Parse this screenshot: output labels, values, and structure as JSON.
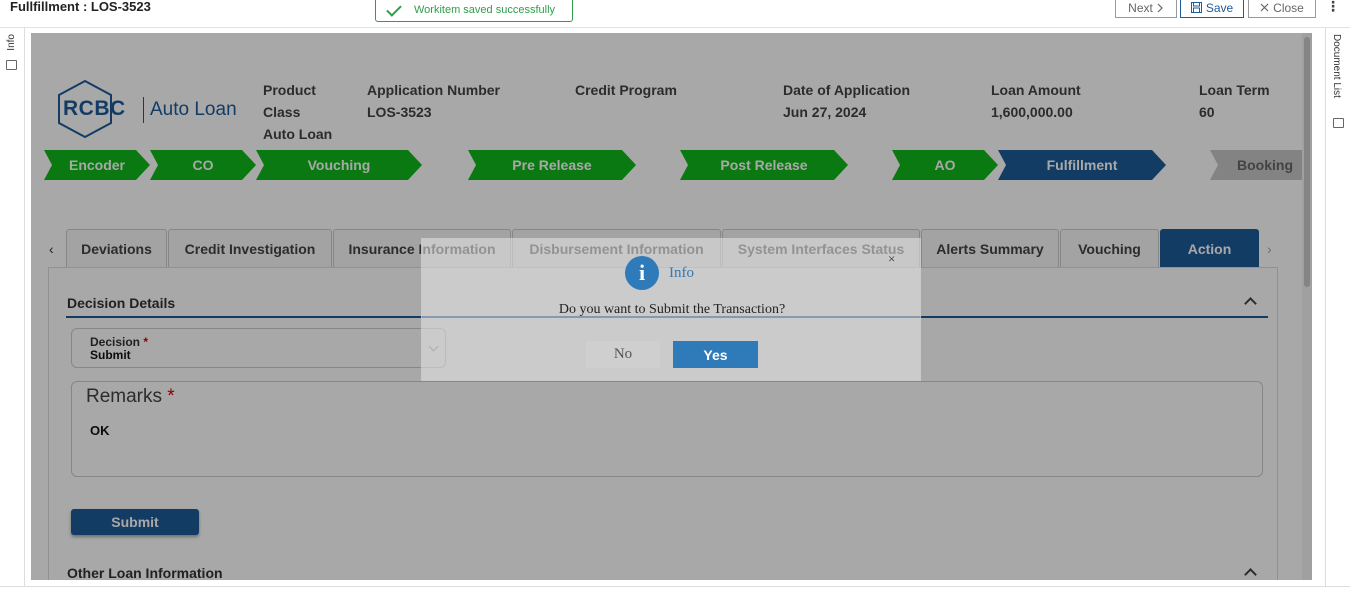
{
  "window": {
    "title": "Fullfillment : LOS-3523"
  },
  "toast": {
    "message": "Workitem saved successfully"
  },
  "toolbar": {
    "next_label": "Next",
    "save_label": "Save",
    "close_label": "Close"
  },
  "left_panel": {
    "label": "Info"
  },
  "right_panel": {
    "label": "Document List"
  },
  "brand": {
    "mark": "RCBC",
    "product": "Auto Loan"
  },
  "application": {
    "product_class_label_1": "Product",
    "product_class_label_2": "Class",
    "product_class_value": "Auto Loan",
    "app_number_label": "Application Number",
    "app_number_value": "LOS-3523",
    "credit_program_label": "Credit Program",
    "credit_program_value": "",
    "date_label": "Date of Application",
    "date_value": "Jun 27, 2024",
    "amount_label": "Loan Amount",
    "amount_value": "1,600,000.00",
    "term_label": "Loan Term",
    "term_value": "60"
  },
  "stages": [
    {
      "label": "Encoder",
      "status": "complete"
    },
    {
      "label": "CO",
      "status": "complete"
    },
    {
      "label": "Vouching",
      "status": "complete"
    },
    {
      "label": "Pre Release",
      "status": "complete"
    },
    {
      "label": "Post Release",
      "status": "complete"
    },
    {
      "label": "AO",
      "status": "complete"
    },
    {
      "label": "Fulfillment",
      "status": "current"
    },
    {
      "label": "Booking",
      "status": "pending"
    }
  ],
  "tabs": [
    {
      "label": "Deviations"
    },
    {
      "label": "Credit Investigation"
    },
    {
      "label": "Insurance Information"
    },
    {
      "label": "Disbursement Information"
    },
    {
      "label": "System Interfaces Status"
    },
    {
      "label": "Alerts Summary"
    },
    {
      "label": "Vouching"
    },
    {
      "label": "Action",
      "active": true
    }
  ],
  "decision_section": {
    "title": "Decision Details",
    "decision_label": "Decision",
    "required_mark": "*",
    "decision_value": "Submit",
    "remarks_label": "Remarks",
    "remarks_value": "OK",
    "submit_label": "Submit"
  },
  "other_section": {
    "title": "Other Loan Information"
  },
  "dialog": {
    "title": "Info",
    "icon_glyph": "i",
    "close_glyph": "×",
    "question": "Do you want to Submit the Transaction?",
    "no_label": "No",
    "yes_label": "Yes"
  },
  "colors": {
    "brand_blue": "#1e5b9a",
    "stage_green": "#10b81a",
    "success_green": "#2e9e4a",
    "dialog_blue": "#2f7ab8"
  }
}
